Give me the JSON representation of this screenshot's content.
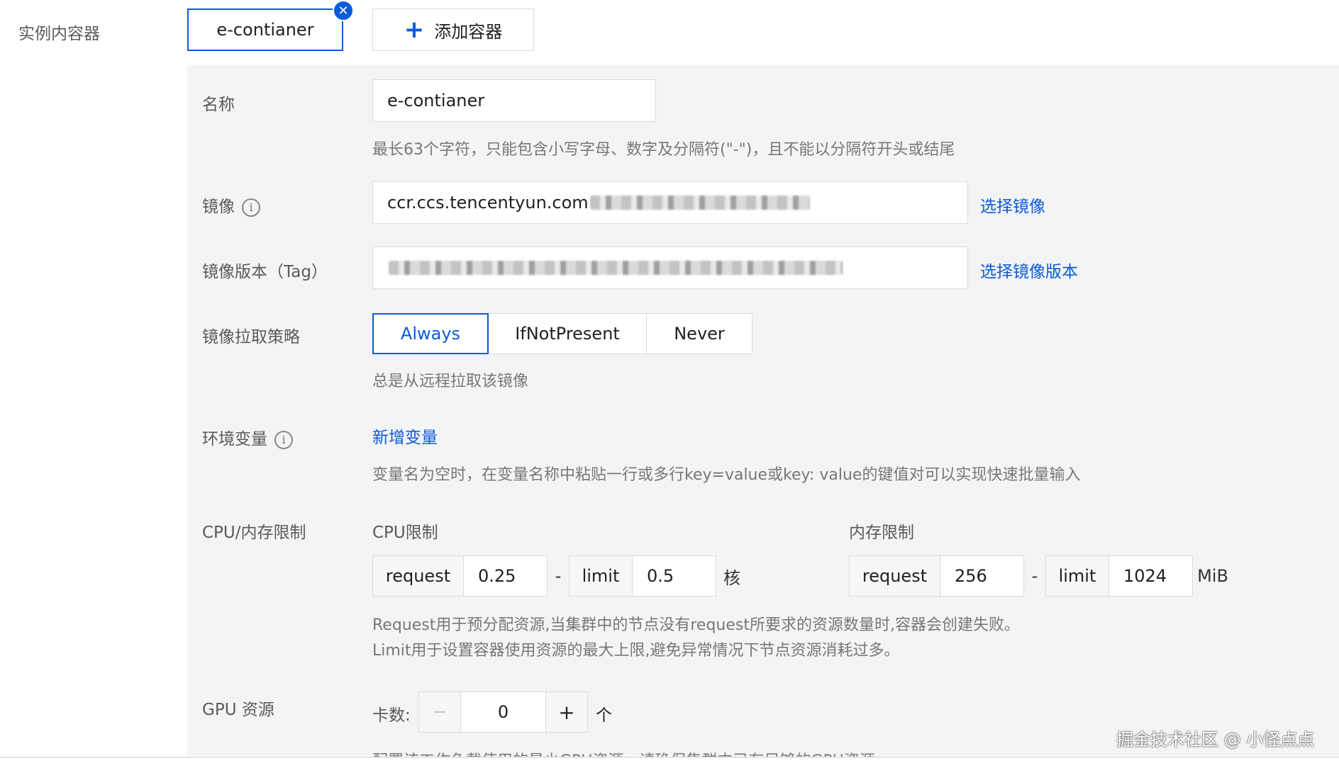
{
  "instance_containers": {
    "label": "实例内容器",
    "tab_name": "e-contianer",
    "add_button_label": "添加容器"
  },
  "form": {
    "name": {
      "label": "名称",
      "value": "e-contianer",
      "hint": "最长63个字符，只能包含小写字母、数字及分隔符(\"-\")，且不能以分隔符开头或结尾"
    },
    "image": {
      "label": "镜像",
      "value": "ccr.ccs.tencentyun.com",
      "link": "选择镜像"
    },
    "image_tag": {
      "label": "镜像版本（Tag）",
      "link": "选择镜像版本"
    },
    "pull_policy": {
      "label": "镜像拉取策略",
      "options": [
        "Always",
        "IfNotPresent",
        "Never"
      ],
      "selected": "Always",
      "hint": "总是从远程拉取该镜像"
    },
    "env": {
      "label": "环境变量",
      "link": "新增变量",
      "hint": "变量名为空时，在变量名称中粘贴一行或多行key=value或key: value的键值对可以实现快速批量输入"
    },
    "resources": {
      "label": "CPU/内存限制",
      "cpu": {
        "title": "CPU限制",
        "request_label": "request",
        "request_value": "0.25",
        "limit_label": "limit",
        "limit_value": "0.5",
        "unit": "核"
      },
      "memory": {
        "title": "内存限制",
        "request_label": "request",
        "request_value": "256",
        "limit_label": "limit",
        "limit_value": "1024",
        "unit": "MiB"
      },
      "separator": "-",
      "hint_line1": "Request用于预分配资源,当集群中的节点没有request所要求的资源数量时,容器会创建失败。",
      "hint_line2": "Limit用于设置容器使用资源的最大上限,避免异常情况下节点资源消耗过多。"
    },
    "gpu": {
      "label": "GPU 资源",
      "count_label": "卡数:",
      "value": "0",
      "decrement": "−",
      "increment": "+",
      "unit": "个",
      "hint": "配置该工作负载使用的最少GPU资源，请确保集群内已有足够的GPU资源"
    }
  },
  "watermark": "掘金技术社区 @ 小怪点点",
  "colors": {
    "accent": "#0a5bd9",
    "panel_bg": "#f3f4f6",
    "border": "#dcdcdc"
  }
}
